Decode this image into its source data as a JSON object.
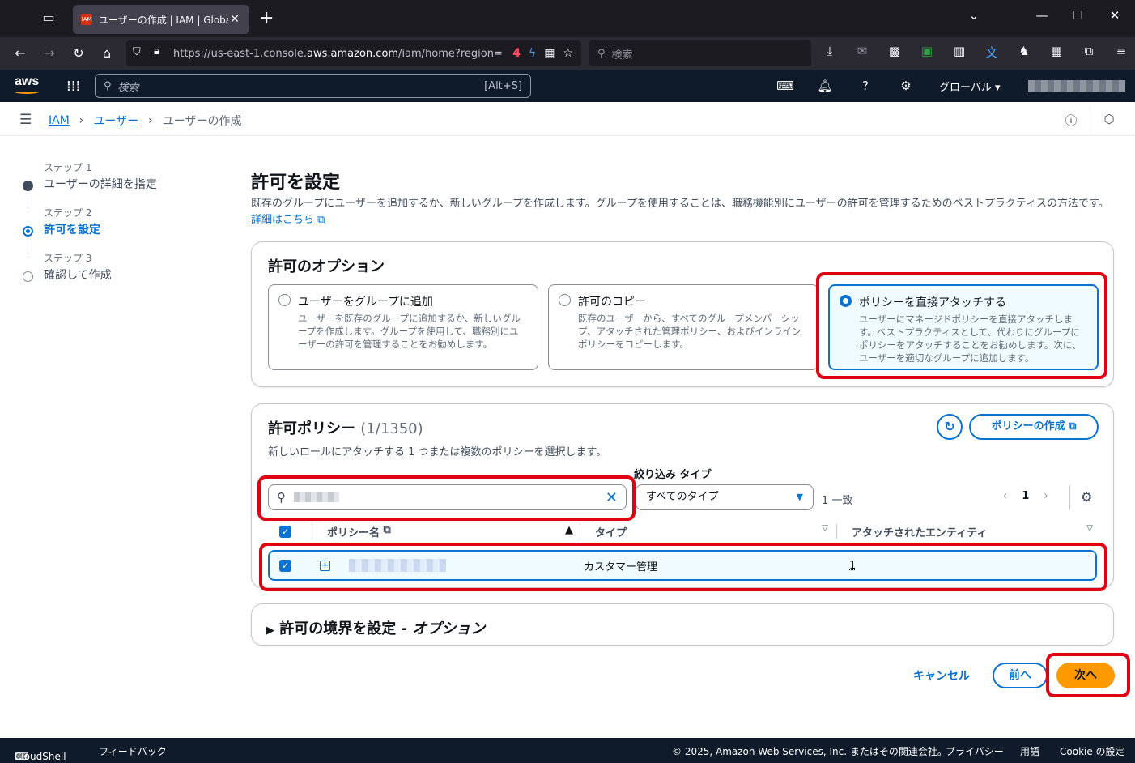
{
  "browser": {
    "tab_title": "ユーザーの作成 | IAM | Global",
    "url_prefix": "https://us-east-1.console.",
    "url_domain": "aws.amazon.com",
    "url_suffix": "/iam/home?region=",
    "search_placeholder": "検索",
    "badge_text": "4"
  },
  "aws_header": {
    "logo": "aws",
    "search_placeholder": "検索",
    "search_shortcut": "[Alt+S]",
    "region": "グローバル ▾"
  },
  "breadcrumb": {
    "items": [
      "IAM",
      "ユーザー"
    ],
    "current": "ユーザーの作成"
  },
  "steps": [
    {
      "num": "ステップ 1",
      "label": "ユーザーの詳細を指定",
      "state": "done"
    },
    {
      "num": "ステップ 2",
      "label": "許可を設定",
      "state": "active"
    },
    {
      "num": "ステップ 3",
      "label": "確認して作成",
      "state": "todo"
    }
  ],
  "page": {
    "title": "許可を設定",
    "description": "既存のグループにユーザーを追加するか、新しいグループを作成します。グループを使用することは、職務機能別にユーザーの許可を管理するためのベストプラクティスの方法です。",
    "learn_more": "詳細はこちら"
  },
  "permission_options": {
    "title": "許可のオプション",
    "options": [
      {
        "title": "ユーザーをグループに追加",
        "desc": "ユーザーを既存のグループに追加するか、新しいグループを作成します。グループを使用して、職務別にユーザーの許可を管理することをお勧めします。",
        "selected": false
      },
      {
        "title": "許可のコピー",
        "desc": "既存のユーザーから、すべてのグループメンバーシップ、アタッチされた管理ポリシー、およびインラインポリシーをコピーします。",
        "selected": false
      },
      {
        "title": "ポリシーを直接アタッチする",
        "desc": "ユーザーにマネージドポリシーを直接アタッチします。ベストプラクティスとして、代わりにグループにポリシーをアタッチすることをお勧めします。次に、ユーザーを適切なグループに追加します。",
        "selected": true
      }
    ]
  },
  "policies": {
    "title": "許可ポリシー",
    "count": "(1/1350)",
    "description": "新しいロールにアタッチする 1 つまたは複数のポリシーを選択します。",
    "create_button": "ポリシーの作成",
    "filter_label": "絞り込み タイプ",
    "filter_value": "すべてのタイプ",
    "match_count": "1 一致",
    "page": "1",
    "columns": [
      "ポリシー名",
      "タイプ",
      "アタッチされたエンティティ"
    ],
    "rows": [
      {
        "type": "カスタマー管理",
        "entities": "1",
        "checked": true
      }
    ]
  },
  "boundary": {
    "title": "許可の境界を設定 - ",
    "optional": "オプション"
  },
  "actions": {
    "cancel": "キャンセル",
    "previous": "前へ",
    "next": "次へ"
  },
  "footer": {
    "cloudshell": "CloudShell",
    "feedback": "フィードバック",
    "copyright": "© 2025, Amazon Web Services, Inc. またはその関連会社。",
    "privacy": "プライバシー",
    "terms": "用語",
    "cookie": "Cookie の設定"
  },
  "colors": {
    "accent": "#0972d3",
    "primary_button": "#ff9900",
    "annotation": "#e00012"
  }
}
